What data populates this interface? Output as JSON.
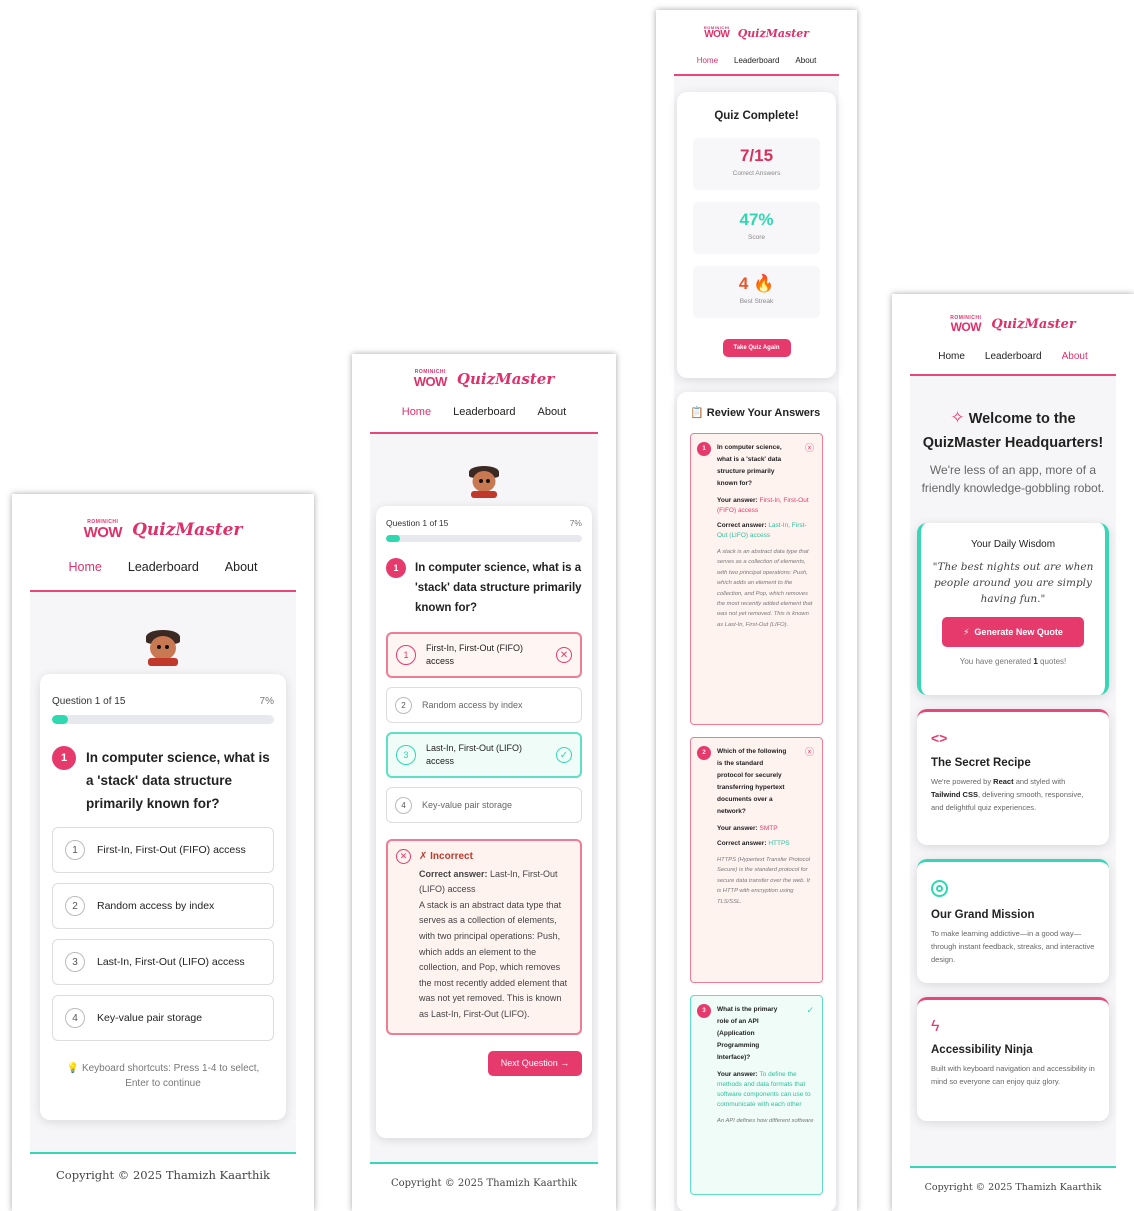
{
  "brand": {
    "wow_small": "ROMINICHI",
    "wow": "WOW",
    "name": "QuizMaster"
  },
  "nav": [
    "Home",
    "Leaderboard",
    "About"
  ],
  "footer": "Copyright © 2025 Thamizh Kaarthik",
  "quiz": {
    "progress_label": "Question 1 of 15",
    "progress_pct": "7%",
    "progress_value": 0.07,
    "question_num": "1",
    "question": "In computer science, what is a 'stack' data structure primarily known for?",
    "options": [
      {
        "num": "1",
        "text": "First-In, First-Out (FIFO) access"
      },
      {
        "num": "2",
        "text": "Random access by index"
      },
      {
        "num": "3",
        "text": "Last-In, First-Out (LIFO) access"
      },
      {
        "num": "4",
        "text": "Key-value pair storage"
      }
    ],
    "hint": "💡 Keyboard shortcuts: Press 1-4 to select, Enter to continue"
  },
  "feedback": {
    "title": "✗ Incorrect",
    "correct_label": "Correct answer:",
    "correct_value": "Last-In, First-Out (LIFO) access",
    "explanation": "A stack is an abstract data type that serves as a collection of elements, with two principal operations: Push, which adds an element to the collection, and Pop, which removes the most recently added element that was not yet removed. This is known as Last-In, First-Out (LIFO).",
    "next_button": "Next Question →"
  },
  "results": {
    "title": "Quiz Complete!",
    "correct": "7/15",
    "correct_label": "Correct Answers",
    "score": "47%",
    "score_label": "Score",
    "streak": "4 🔥",
    "streak_label": "Best Streak",
    "retake": "Take Quiz Again",
    "review_title": "📋 Review Your Answers",
    "your_answer_label": "Your answer:",
    "correct_answer_label": "Correct answer:",
    "reviews": [
      {
        "num": "1",
        "q": "In computer science, what is a 'stack' data structure primarily known for?",
        "yours": "First-In, First-Out (FIFO) access",
        "correct": "Last-In, First-Out (LIFO) access",
        "exp": "A stack is an abstract data type that serves as a collection of elements, with two principal operations: Push, which adds an element to the collection, and Pop, which removes the most recently added element that was not yet removed. This is known as Last-In, First-Out (LIFO)."
      },
      {
        "num": "2",
        "q": "Which of the following is the standard protocol for securely transferring hypertext documents over a network?",
        "yours": "SMTP",
        "correct": "HTTPS",
        "exp": "HTTPS (Hypertext Transfer Protocol Secure) is the standard protocol for secure data transfer over the web. It is HTTP with encryption using TLS/SSL."
      },
      {
        "num": "3",
        "q": "What is the primary role of an API (Application Programming Interface)?",
        "yours": "To define the methods and data formats that software components can use to communicate with each other",
        "exp": "An API defines how different software"
      }
    ]
  },
  "about": {
    "welcome": "Welcome to the QuizMaster Headquarters!",
    "tagline": "We're less of an app, more of a friendly knowledge-gobbling robot.",
    "wisdom_title": "Your Daily Wisdom",
    "wisdom_quote": "\"The best nights out are when people around you are simply having fun.\"",
    "generate_button": "Generate New Quote",
    "generated_prefix": "You have generated",
    "generated_count": "1",
    "generated_suffix": "quotes!",
    "cards": [
      {
        "title": "The Secret Recipe",
        "text_a": "We're powered by ",
        "bold_a": "React",
        "text_b": " and styled with ",
        "bold_b": "Tailwind CSS",
        "text_c": ", delivering smooth, responsive, and delightful quiz experiences."
      },
      {
        "title": "Our Grand Mission",
        "text": "To make learning addictive—in a good way—through instant feedback, streaks, and interactive design."
      },
      {
        "title": "Accessibility Ninja",
        "text": "Built with keyboard navigation and accessibility in mind so everyone can enjoy quiz glory."
      }
    ]
  },
  "colors": {
    "accent": "#e63a6c",
    "teal": "#2fd9b0",
    "wrong_bg": "#fff3f0",
    "right_bg": "#eefcf7"
  }
}
